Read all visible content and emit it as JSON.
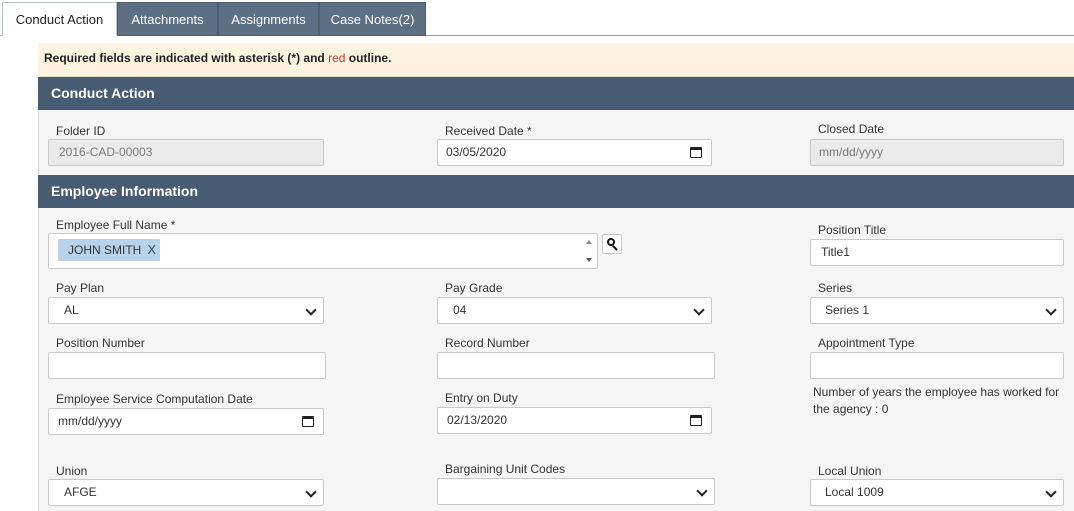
{
  "tabs": [
    {
      "label": "Conduct Action",
      "active": true
    },
    {
      "label": "Attachments",
      "active": false
    },
    {
      "label": "Assignments",
      "active": false
    },
    {
      "label": "Case Notes(2)",
      "active": false
    }
  ],
  "notice": {
    "prefix": "Required fields are indicated with asterisk (*) and ",
    "red_word": "red",
    "suffix": " outline."
  },
  "sections": {
    "conduct_action": "Conduct Action",
    "employee_information": "Employee Information"
  },
  "fields": {
    "folder_id": {
      "label": "Folder ID",
      "value": "2016-CAD-00003"
    },
    "received_date": {
      "label": "Received Date *",
      "value": "03/05/2020"
    },
    "closed_date": {
      "label": "Closed Date",
      "value": "mm/dd/yyyy"
    },
    "employee_full_name": {
      "label": "Employee Full Name *",
      "selected": "JOHN SMITH",
      "remove": "X"
    },
    "position_title": {
      "label": "Position Title",
      "value": "Title1"
    },
    "pay_plan": {
      "label": "Pay Plan",
      "value": "AL"
    },
    "pay_grade": {
      "label": "Pay Grade",
      "value": "04"
    },
    "series": {
      "label": "Series",
      "value": "Series 1"
    },
    "position_number": {
      "label": "Position Number",
      "value": ""
    },
    "record_number": {
      "label": "Record Number",
      "value": ""
    },
    "appointment_type": {
      "label": "Appointment Type",
      "value": ""
    },
    "service_computation_date": {
      "label": "Employee Service Computation Date",
      "value": "mm/dd/yyyy"
    },
    "entry_on_duty": {
      "label": "Entry on Duty",
      "value": "02/13/2020"
    },
    "years_worked": {
      "text": "Number of years the employee has worked for the agency : 0"
    },
    "union": {
      "label": "Union",
      "value": "AFGE"
    },
    "bargaining_unit_codes": {
      "label": "Bargaining Unit Codes",
      "value": ""
    },
    "local_union": {
      "label": "Local Union",
      "value": "Local 1009"
    }
  },
  "colors": {
    "section_header": "#475b73",
    "tab_inactive": "#5c6f83",
    "notice_bg": "#fcf3e1",
    "chip_bg": "#b8d3ea",
    "required_red": "#c0392b"
  },
  "icons": [
    "calendar-icon",
    "chevron-down-icon",
    "search-icon",
    "remove-icon"
  ]
}
